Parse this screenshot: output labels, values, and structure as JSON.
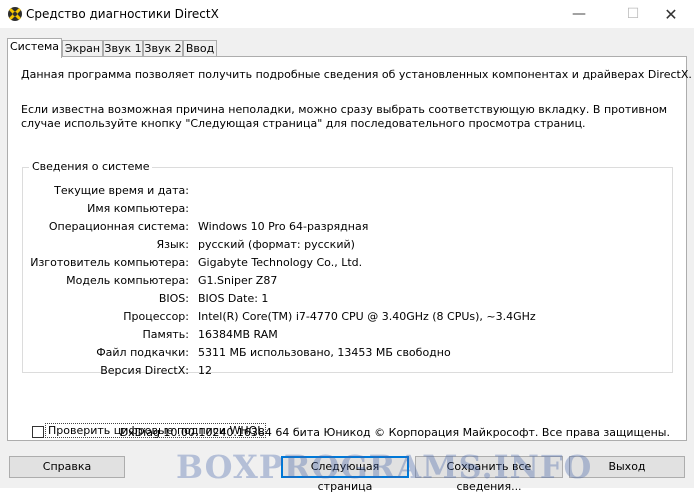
{
  "window": {
    "title": "Средство диагностики DirectX",
    "minimize": "—",
    "maximize": "☐",
    "close": "✕"
  },
  "tabs": [
    {
      "label": "Система",
      "active": true
    },
    {
      "label": "Экран",
      "active": false
    },
    {
      "label": "Звук 1",
      "active": false
    },
    {
      "label": "Звук 2",
      "active": false
    },
    {
      "label": "Ввод",
      "active": false
    }
  ],
  "intro": {
    "line1": "Данная программа позволяет получить подробные сведения об установленных компонентах и драйверах DirectX.",
    "line2": "Если известна возможная причина неполадки, можно сразу выбрать соответствующую вкладку. В противном случае используйте кнопку \"Следующая страница\" для последовательного просмотра страниц."
  },
  "system_info": {
    "title": "Сведения о системе",
    "rows": [
      {
        "label": "Текущие время и дата:",
        "value": ""
      },
      {
        "label": "Имя компьютера:",
        "value": ""
      },
      {
        "label": "Операционная система:",
        "value": "Windows 10 Pro 64-разрядная"
      },
      {
        "label": "Язык:",
        "value": "русский (формат: русский)"
      },
      {
        "label": "Изготовитель компьютера:",
        "value": "Gigabyte Technology Co., Ltd."
      },
      {
        "label": "Модель компьютера:",
        "value": "G1.Sniper Z87"
      },
      {
        "label": "BIOS:",
        "value": "BIOS Date: 1"
      },
      {
        "label": "Процессор:",
        "value": "Intel(R) Core(TM) i7-4770 CPU @ 3.40GHz (8 CPUs), ~3.4GHz"
      },
      {
        "label": "Память:",
        "value": "16384MB RAM"
      },
      {
        "label": "Файл подкачки:",
        "value": "5311 МБ использовано, 13453 МБ свободно"
      },
      {
        "label": "Версия DirectX:",
        "value": "12"
      }
    ]
  },
  "whql_checkbox": {
    "label": "Проверить цифровые подписи WHQL",
    "checked": false
  },
  "footer": "DxDiag 10.00.10240.16384 64 бита Юникод © Корпорация Майкрософт. Все права защищены.",
  "buttons": {
    "help": "Справка",
    "next": "Следующая страница",
    "save": "Сохранить все сведения...",
    "exit": "Выход"
  },
  "watermark": "BOXPROGRAMS.INFO"
}
